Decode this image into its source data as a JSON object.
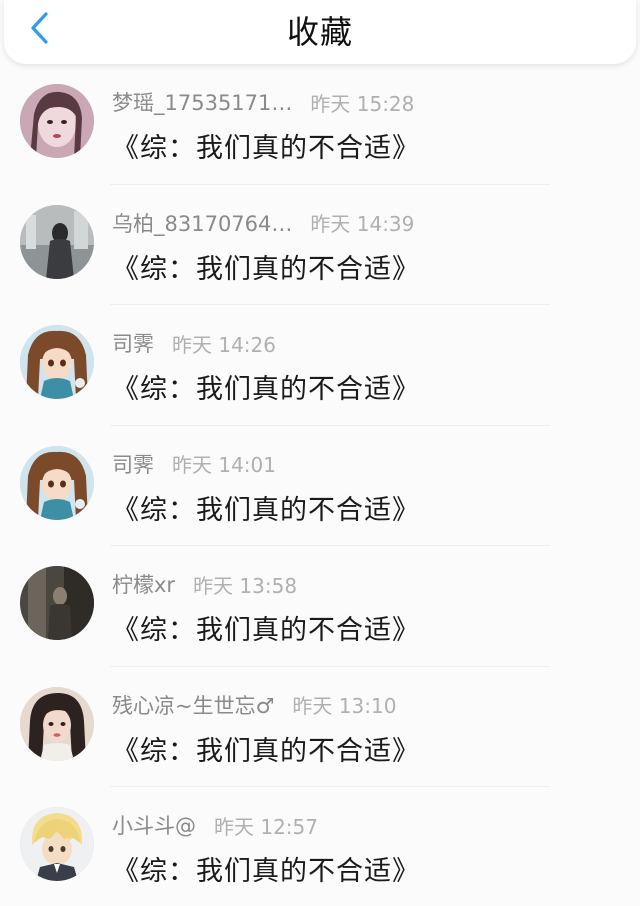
{
  "header": {
    "title": "收藏",
    "back_icon": "chevron-left-icon",
    "accent": "#2f9bf0"
  },
  "items": [
    {
      "username": "梦瑶_17535171…",
      "time": "昨天 15:28",
      "title": "《综：我们真的不合适》"
    },
    {
      "username": "乌柏_83170764…",
      "time": "昨天 14:39",
      "title": "《综：我们真的不合适》"
    },
    {
      "username": "司霁",
      "time": "昨天 14:26",
      "title": "《综：我们真的不合适》"
    },
    {
      "username": "司霁",
      "time": "昨天 14:01",
      "title": "《综：我们真的不合适》"
    },
    {
      "username": "柠檬xr",
      "time": "昨天 13:58",
      "title": "《综：我们真的不合适》"
    },
    {
      "username": "残心凉~生世忘♂",
      "time": "昨天 13:10",
      "title": "《综：我们真的不合适》"
    },
    {
      "username": "小斗斗@",
      "time": "昨天 12:57",
      "title": "《综：我们真的不合适》"
    }
  ]
}
